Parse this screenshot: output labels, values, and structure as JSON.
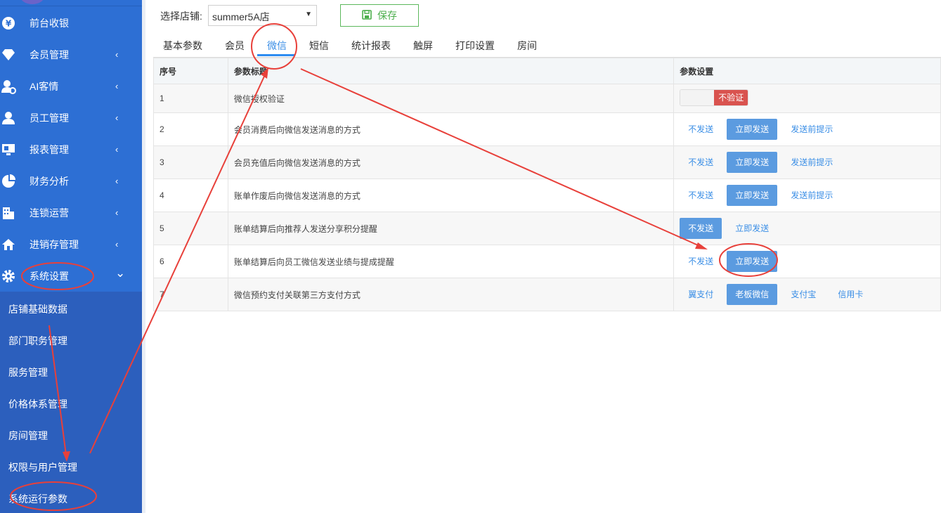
{
  "sidebar": {
    "items": [
      {
        "label": "前台收银",
        "icon": "yen-icon",
        "chevron": ""
      },
      {
        "label": "会员管理",
        "icon": "diamond-icon",
        "chevron": "‹"
      },
      {
        "label": "AI客情",
        "icon": "user-settings-icon",
        "chevron": "‹"
      },
      {
        "label": "员工管理",
        "icon": "user-icon",
        "chevron": "‹"
      },
      {
        "label": "报表管理",
        "icon": "monitor-icon",
        "chevron": "‹"
      },
      {
        "label": "财务分析",
        "icon": "pie-chart-icon",
        "chevron": "‹"
      },
      {
        "label": "连锁运营",
        "icon": "building-icon",
        "chevron": "‹"
      },
      {
        "label": "进销存管理",
        "icon": "home-icon",
        "chevron": "‹"
      },
      {
        "label": "系统设置",
        "icon": "gear-icon",
        "chevron": "⌄"
      }
    ],
    "sub_items": [
      "店铺基础数据",
      "部门职务管理",
      "服务管理",
      "价格体系管理",
      "房间管理",
      "权限与用户管理",
      "系统运行参数"
    ]
  },
  "toolbar": {
    "store_label": "选择店铺:",
    "store_value": "summer5A店",
    "save_label": "保存"
  },
  "tabs": [
    "基本参数",
    "会员",
    "微信",
    "短信",
    "统计报表",
    "触屏",
    "打印设置",
    "房间"
  ],
  "active_tab": "微信",
  "table": {
    "headers": [
      "序号",
      "参数标题",
      "参数设置"
    ],
    "rows": [
      {
        "no": "1",
        "title": "微信授权验证",
        "toggle": "不验证"
      },
      {
        "no": "2",
        "title": "会员消费后向微信发送消息的方式",
        "options": [
          "不发送",
          "立即发送",
          "发送前提示"
        ],
        "selected": 1
      },
      {
        "no": "3",
        "title": "会员充值后向微信发送消息的方式",
        "options": [
          "不发送",
          "立即发送",
          "发送前提示"
        ],
        "selected": 1
      },
      {
        "no": "4",
        "title": "账单作废后向微信发送消息的方式",
        "options": [
          "不发送",
          "立即发送",
          "发送前提示"
        ],
        "selected": 1
      },
      {
        "no": "5",
        "title": "账单结算后向推荐人发送分享积分提醒",
        "options": [
          "不发送",
          "立即发送"
        ],
        "selected": 0
      },
      {
        "no": "6",
        "title": "账单结算后向员工微信发送业绩与提成提醒",
        "options": [
          "不发送",
          "立即发送"
        ],
        "selected": 1
      },
      {
        "no": "7",
        "title": "微信预约支付关联第三方支付方式",
        "options": [
          "翼支付",
          "老板微信",
          "支付宝",
          "信用卡"
        ],
        "selected": 1
      }
    ]
  },
  "colors": {
    "sidebar_bg": "#2d6fd4",
    "accent": "#3a8ee6",
    "selected_option": "#5b9be0",
    "danger": "#d9534f",
    "annotation": "#e8403a"
  }
}
